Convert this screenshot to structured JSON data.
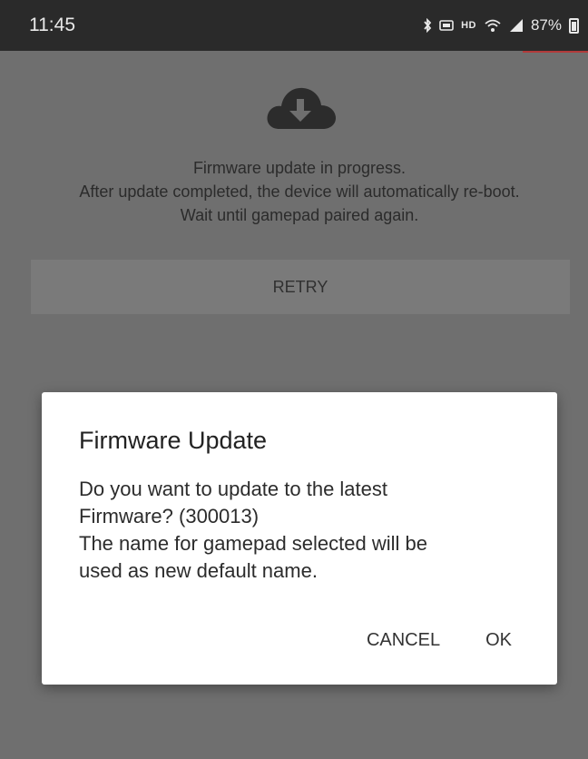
{
  "status_bar": {
    "time": "11:45",
    "network_label": "HD",
    "battery_percent": "87%",
    "icons": [
      "bluetooth-icon",
      "battery-saver-icon",
      "hd-voice-icon",
      "wifi-icon",
      "signal-icon",
      "battery-icon"
    ]
  },
  "main": {
    "icon": "cloud-download-icon",
    "message_lines": [
      "Firmware update in progress.",
      "After update completed, the device will automatically re-boot.",
      "Wait until gamepad paired again."
    ],
    "retry_label": "RETRY"
  },
  "dialog": {
    "title": "Firmware Update",
    "body_lines": [
      "Do you want to update to the latest",
      "Firmware? (300013)",
      "The name for gamepad selected will be",
      "used as new default name."
    ],
    "cancel_label": "CANCEL",
    "ok_label": "OK"
  }
}
